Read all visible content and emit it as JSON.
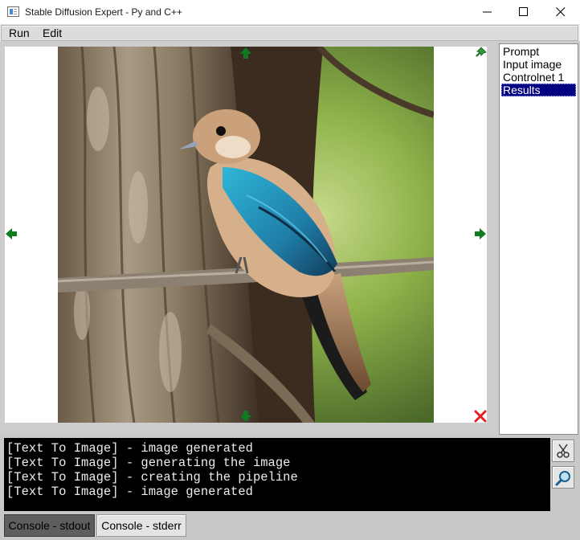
{
  "window": {
    "title": "Stable Diffusion Expert - Py and C++"
  },
  "menu": {
    "run_label": "Run",
    "edit_label": "Edit"
  },
  "sidebar": {
    "items": [
      {
        "label": "Prompt",
        "selected": false
      },
      {
        "label": "Input image",
        "selected": false
      },
      {
        "label": "Controlnet 1",
        "selected": false
      },
      {
        "label": "Results",
        "selected": true
      }
    ]
  },
  "console": {
    "lines": [
      "[Text To Image] - image generated",
      "[Text To Image] - generating the image",
      "[Text To Image] - creating the pipeline",
      "[Text To Image] - image generated"
    ]
  },
  "tabs": [
    {
      "label": "Console - stdout",
      "active": true
    },
    {
      "label": "Console - stderr",
      "active": false
    }
  ],
  "icons": {
    "pin": "pin-icon",
    "delete": "delete-icon",
    "clear": "scissors-icon",
    "search": "magnifier-icon",
    "arrows": [
      "arrow-up-icon",
      "arrow-down-icon",
      "arrow-left-icon",
      "arrow-right-icon"
    ]
  },
  "colors": {
    "selection": "#000080",
    "arrow_green": "#0f7a1e",
    "delete_red": "#e22020",
    "console_bg": "#000000",
    "console_text": "#ececec"
  }
}
